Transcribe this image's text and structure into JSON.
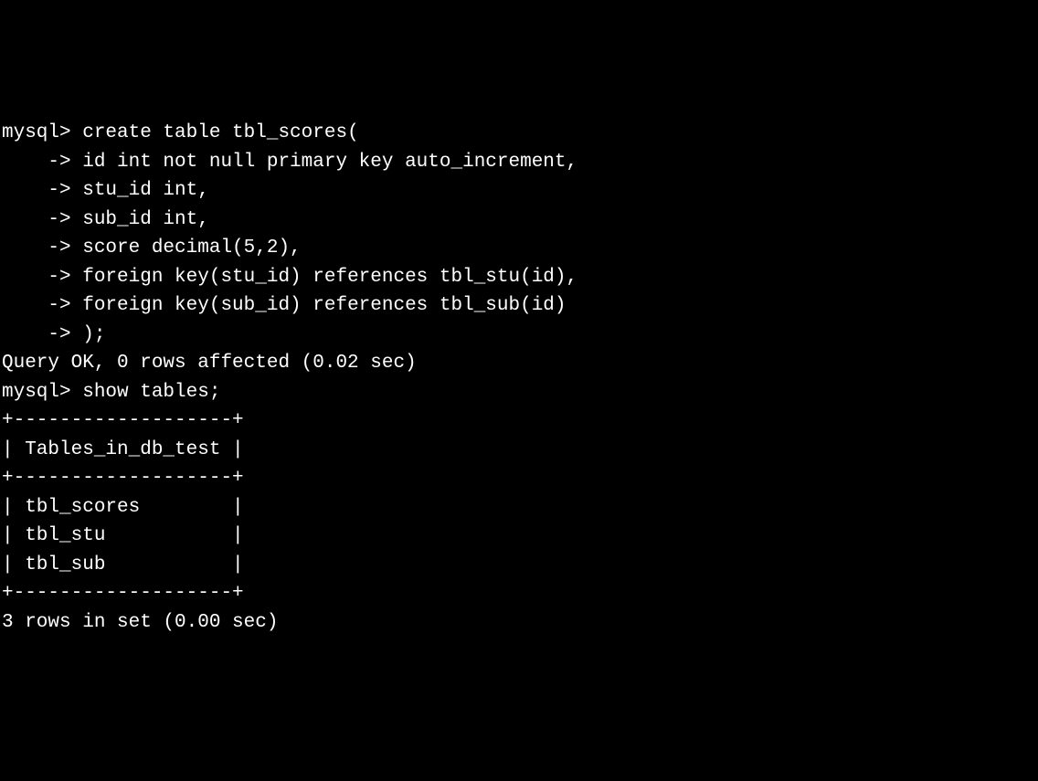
{
  "terminal": {
    "prompt_main": "mysql> ",
    "prompt_cont": "    -> ",
    "command1_lines": [
      "create table tbl_scores(",
      "id int not null primary key auto_increment,",
      "stu_id int,",
      "sub_id int,",
      "score decimal(5,2),",
      "foreign key(stu_id) references tbl_stu(id),",
      "foreign key(sub_id) references tbl_sub(id)",
      ");"
    ],
    "result1": "Query OK, 0 rows affected (0.02 sec)",
    "blank": "",
    "command2": "show tables;",
    "table_border": "+-------------------+",
    "table_header": "| Tables_in_db_test |",
    "table_rows": [
      "| tbl_scores        |",
      "| tbl_stu           |",
      "| tbl_sub           |"
    ],
    "result2": "3 rows in set (0.00 sec)"
  }
}
